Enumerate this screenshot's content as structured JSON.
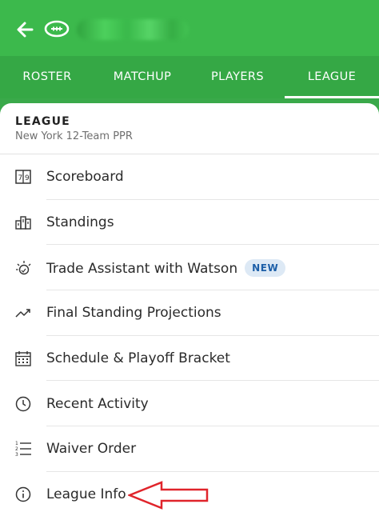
{
  "header": {
    "back_icon": "arrow-left-icon",
    "team_icon": "football-icon",
    "team_name": "",
    "bg_color": "#3cb94c"
  },
  "tabs": [
    {
      "label": "ROSTER",
      "active": false
    },
    {
      "label": "MATCHUP",
      "active": false
    },
    {
      "label": "PLAYERS",
      "active": false
    },
    {
      "label": "LEAGUE",
      "active": true
    }
  ],
  "sheet": {
    "title": "LEAGUE",
    "subtitle": "New York 12-Team PPR",
    "items": [
      {
        "label": "Scoreboard",
        "icon": "scoreboard-icon"
      },
      {
        "label": "Standings",
        "icon": "standings-icon"
      },
      {
        "label": "Trade Assistant with Watson",
        "icon": "lightbulb-icon",
        "badge": "NEW"
      },
      {
        "label": "Final Standing Projections",
        "icon": "trend-up-icon"
      },
      {
        "label": "Schedule & Playoff Bracket",
        "icon": "calendar-icon"
      },
      {
        "label": "Recent Activity",
        "icon": "clock-icon"
      },
      {
        "label": "Waiver Order",
        "icon": "numbered-list-icon"
      },
      {
        "label": "League Info",
        "icon": "info-icon"
      }
    ]
  },
  "annotation": {
    "icon": "red-arrow-pointer-icon",
    "color": "#e0242b"
  }
}
